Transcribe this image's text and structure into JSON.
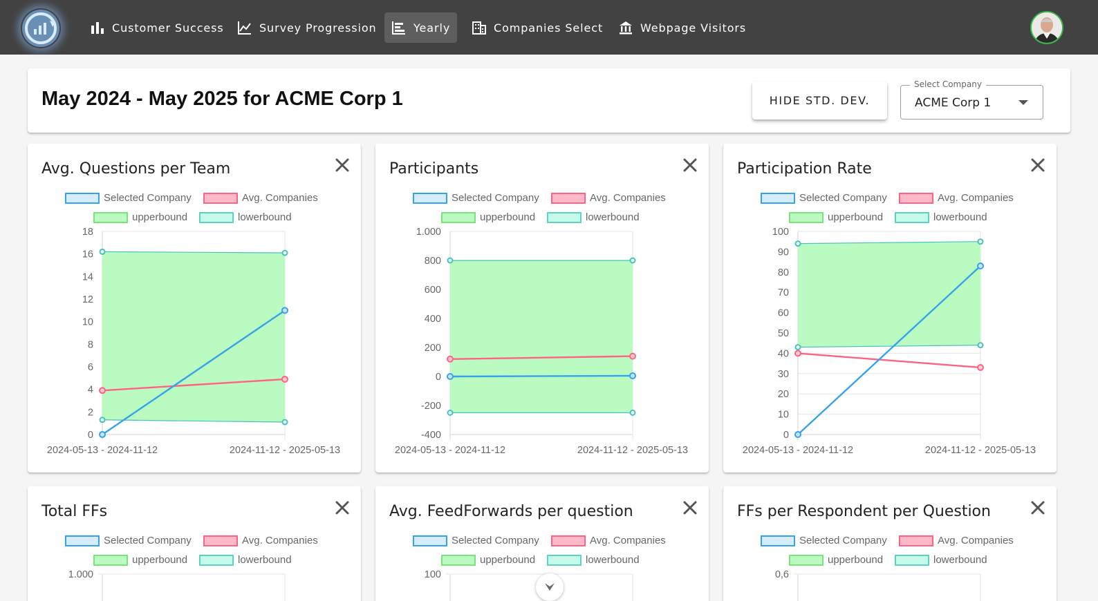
{
  "nav": {
    "items": [
      {
        "label": "Customer Success",
        "icon": "bar-chart-icon",
        "active": false
      },
      {
        "label": "Survey Progression",
        "icon": "line-chart-icon",
        "active": false
      },
      {
        "label": "Yearly",
        "icon": "timeline-icon",
        "active": true
      },
      {
        "label": "Companies Select",
        "icon": "building-icon",
        "active": false
      },
      {
        "label": "Webpage Visitors",
        "icon": "bank-icon",
        "active": false
      }
    ]
  },
  "header": {
    "title": "May 2024 - May 2025 for ACME Corp 1",
    "hide_button": "HIDE STD. DEV.",
    "select_label": "Select Company",
    "select_value": "ACME Corp 1"
  },
  "legend": {
    "selected": "Selected Company",
    "avg": "Avg. Companies",
    "upper": "upperbound",
    "lower": "lowerbound"
  },
  "colors": {
    "selected": "#36a2eb",
    "avg": "#ff6384",
    "band_fill": "#b9fbc0",
    "band_line": "#4bc0c0",
    "topbar": "#424242"
  },
  "chart_data": [
    {
      "type": "line",
      "title": "Avg. Questions per Team",
      "categories": [
        "2024-05-13 - 2024-11-12",
        "2024-11-12 - 2025-05-13"
      ],
      "series": [
        {
          "name": "Selected Company",
          "values": [
            0,
            11
          ]
        },
        {
          "name": "Avg. Companies",
          "values": [
            3.9,
            4.9
          ]
        },
        {
          "name": "upperbound",
          "values": [
            16.2,
            16.1
          ]
        },
        {
          "name": "lowerbound",
          "values": [
            1.3,
            1.1
          ]
        }
      ],
      "ylim": [
        0,
        18
      ],
      "yticks": [
        "0",
        "2",
        "4",
        "6",
        "8",
        "10",
        "12",
        "14",
        "16",
        "18"
      ]
    },
    {
      "type": "line",
      "title": "Participants",
      "categories": [
        "2024-05-13 - 2024-11-12",
        "2024-11-12 - 2025-05-13"
      ],
      "series": [
        {
          "name": "Selected Company",
          "values": [
            0,
            5
          ]
        },
        {
          "name": "Avg. Companies",
          "values": [
            120,
            140
          ]
        },
        {
          "name": "upperbound",
          "values": [
            800,
            800
          ]
        },
        {
          "name": "lowerbound",
          "values": [
            -250,
            -250
          ]
        }
      ],
      "ylim": [
        -400,
        1000
      ],
      "yticks": [
        "-400",
        "-200",
        "0",
        "200",
        "400",
        "600",
        "800",
        "1.000"
      ]
    },
    {
      "type": "line",
      "title": "Participation Rate",
      "categories": [
        "2024-05-13 - 2024-11-12",
        "2024-11-12 - 2025-05-13"
      ],
      "series": [
        {
          "name": "Selected Company",
          "values": [
            0,
            83
          ]
        },
        {
          "name": "Avg. Companies",
          "values": [
            40,
            33
          ]
        },
        {
          "name": "upperbound",
          "values": [
            94,
            95
          ]
        },
        {
          "name": "lowerbound",
          "values": [
            43,
            44
          ]
        }
      ],
      "ylim": [
        0,
        100
      ],
      "yticks": [
        "0",
        "10",
        "20",
        "30",
        "40",
        "50",
        "60",
        "70",
        "80",
        "90",
        "100"
      ]
    },
    {
      "type": "line",
      "title": "Total FFs",
      "categories": [],
      "series": [],
      "ylim": [
        0,
        1000
      ],
      "yticks": [
        "1.000"
      ]
    },
    {
      "type": "line",
      "title": "Avg. FeedForwards per question",
      "categories": [],
      "series": [],
      "ylim": [
        0,
        100
      ],
      "yticks": [
        "100"
      ]
    },
    {
      "type": "line",
      "title": "FFs per Respondent per Question",
      "categories": [],
      "series": [],
      "ylim": [
        0,
        0.6
      ],
      "yticks": [
        "0,6"
      ]
    }
  ]
}
